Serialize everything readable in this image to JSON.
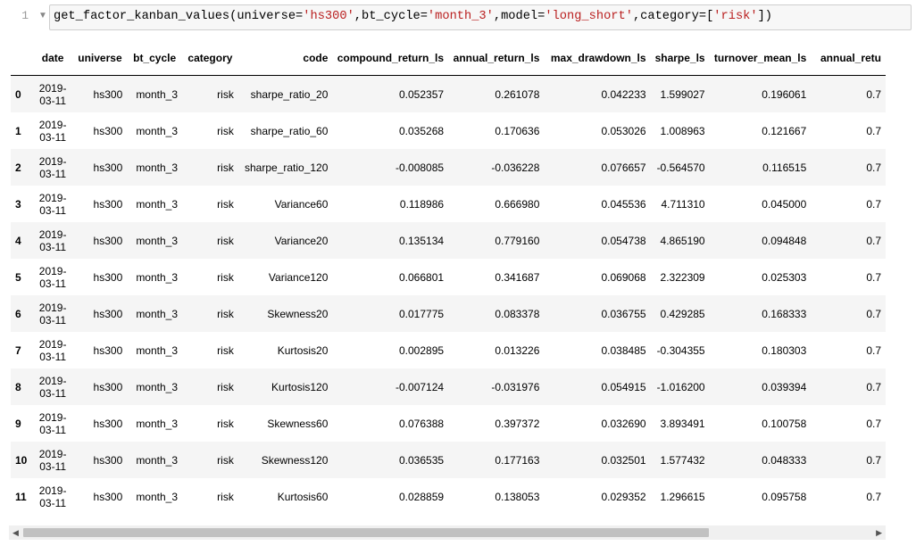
{
  "cell": {
    "line_number": "1",
    "code_parts": [
      {
        "t": "get_factor_kanban_values(universe=",
        "c": "plain"
      },
      {
        "t": "'hs300'",
        "c": "str"
      },
      {
        "t": ",bt_cycle=",
        "c": "plain"
      },
      {
        "t": "'month_3'",
        "c": "str"
      },
      {
        "t": ",model=",
        "c": "plain"
      },
      {
        "t": "'long_short'",
        "c": "str"
      },
      {
        "t": ",category=[",
        "c": "plain"
      },
      {
        "t": "'risk'",
        "c": "str"
      },
      {
        "t": "])",
        "c": "plain"
      }
    ]
  },
  "table": {
    "columns": [
      "date",
      "universe",
      "bt_cycle",
      "category",
      "code",
      "compound_return_ls",
      "annual_return_ls",
      "max_drawdown_ls",
      "sharpe_ls",
      "turnover_mean_ls",
      "annual_retu"
    ],
    "rows": [
      {
        "idx": "0",
        "date_a": "2019-",
        "date_b": "03-11",
        "universe": "hs300",
        "bt_cycle": "month_3",
        "category": "risk",
        "code": "sharpe_ratio_20",
        "compound_return_ls": "0.052357",
        "annual_return_ls": "0.261078",
        "max_drawdown_ls": "0.042233",
        "sharpe_ls": "1.599027",
        "turnover_mean_ls": "0.196061",
        "annual_retu": "0.7"
      },
      {
        "idx": "1",
        "date_a": "2019-",
        "date_b": "03-11",
        "universe": "hs300",
        "bt_cycle": "month_3",
        "category": "risk",
        "code": "sharpe_ratio_60",
        "compound_return_ls": "0.035268",
        "annual_return_ls": "0.170636",
        "max_drawdown_ls": "0.053026",
        "sharpe_ls": "1.008963",
        "turnover_mean_ls": "0.121667",
        "annual_retu": "0.7"
      },
      {
        "idx": "2",
        "date_a": "2019-",
        "date_b": "03-11",
        "universe": "hs300",
        "bt_cycle": "month_3",
        "category": "risk",
        "code": "sharpe_ratio_120",
        "compound_return_ls": "-0.008085",
        "annual_return_ls": "-0.036228",
        "max_drawdown_ls": "0.076657",
        "sharpe_ls": "-0.564570",
        "turnover_mean_ls": "0.116515",
        "annual_retu": "0.7"
      },
      {
        "idx": "3",
        "date_a": "2019-",
        "date_b": "03-11",
        "universe": "hs300",
        "bt_cycle": "month_3",
        "category": "risk",
        "code": "Variance60",
        "compound_return_ls": "0.118986",
        "annual_return_ls": "0.666980",
        "max_drawdown_ls": "0.045536",
        "sharpe_ls": "4.711310",
        "turnover_mean_ls": "0.045000",
        "annual_retu": "0.7"
      },
      {
        "idx": "4",
        "date_a": "2019-",
        "date_b": "03-11",
        "universe": "hs300",
        "bt_cycle": "month_3",
        "category": "risk",
        "code": "Variance20",
        "compound_return_ls": "0.135134",
        "annual_return_ls": "0.779160",
        "max_drawdown_ls": "0.054738",
        "sharpe_ls": "4.865190",
        "turnover_mean_ls": "0.094848",
        "annual_retu": "0.7"
      },
      {
        "idx": "5",
        "date_a": "2019-",
        "date_b": "03-11",
        "universe": "hs300",
        "bt_cycle": "month_3",
        "category": "risk",
        "code": "Variance120",
        "compound_return_ls": "0.066801",
        "annual_return_ls": "0.341687",
        "max_drawdown_ls": "0.069068",
        "sharpe_ls": "2.322309",
        "turnover_mean_ls": "0.025303",
        "annual_retu": "0.7"
      },
      {
        "idx": "6",
        "date_a": "2019-",
        "date_b": "03-11",
        "universe": "hs300",
        "bt_cycle": "month_3",
        "category": "risk",
        "code": "Skewness20",
        "compound_return_ls": "0.017775",
        "annual_return_ls": "0.083378",
        "max_drawdown_ls": "0.036755",
        "sharpe_ls": "0.429285",
        "turnover_mean_ls": "0.168333",
        "annual_retu": "0.7"
      },
      {
        "idx": "7",
        "date_a": "2019-",
        "date_b": "03-11",
        "universe": "hs300",
        "bt_cycle": "month_3",
        "category": "risk",
        "code": "Kurtosis20",
        "compound_return_ls": "0.002895",
        "annual_return_ls": "0.013226",
        "max_drawdown_ls": "0.038485",
        "sharpe_ls": "-0.304355",
        "turnover_mean_ls": "0.180303",
        "annual_retu": "0.7"
      },
      {
        "idx": "8",
        "date_a": "2019-",
        "date_b": "03-11",
        "universe": "hs300",
        "bt_cycle": "month_3",
        "category": "risk",
        "code": "Kurtosis120",
        "compound_return_ls": "-0.007124",
        "annual_return_ls": "-0.031976",
        "max_drawdown_ls": "0.054915",
        "sharpe_ls": "-1.016200",
        "turnover_mean_ls": "0.039394",
        "annual_retu": "0.7"
      },
      {
        "idx": "9",
        "date_a": "2019-",
        "date_b": "03-11",
        "universe": "hs300",
        "bt_cycle": "month_3",
        "category": "risk",
        "code": "Skewness60",
        "compound_return_ls": "0.076388",
        "annual_return_ls": "0.397372",
        "max_drawdown_ls": "0.032690",
        "sharpe_ls": "3.893491",
        "turnover_mean_ls": "0.100758",
        "annual_retu": "0.7"
      },
      {
        "idx": "10",
        "date_a": "2019-",
        "date_b": "03-11",
        "universe": "hs300",
        "bt_cycle": "month_3",
        "category": "risk",
        "code": "Skewness120",
        "compound_return_ls": "0.036535",
        "annual_return_ls": "0.177163",
        "max_drawdown_ls": "0.032501",
        "sharpe_ls": "1.577432",
        "turnover_mean_ls": "0.048333",
        "annual_retu": "0.7"
      },
      {
        "idx": "11",
        "date_a": "2019-",
        "date_b": "03-11",
        "universe": "hs300",
        "bt_cycle": "month_3",
        "category": "risk",
        "code": "Kurtosis60",
        "compound_return_ls": "0.028859",
        "annual_return_ls": "0.138053",
        "max_drawdown_ls": "0.029352",
        "sharpe_ls": "1.296615",
        "turnover_mean_ls": "0.095758",
        "annual_retu": "0.7"
      }
    ]
  },
  "scrollbar": {
    "left_icon": "scroll-left-icon",
    "right_icon": "scroll-right-icon",
    "position_fraction": 0.0,
    "visible_fraction": 0.79
  },
  "colors": {
    "string": "#ba2121",
    "code_bg": "#f7f7f7",
    "row_stripe": "#f5f5f5"
  }
}
